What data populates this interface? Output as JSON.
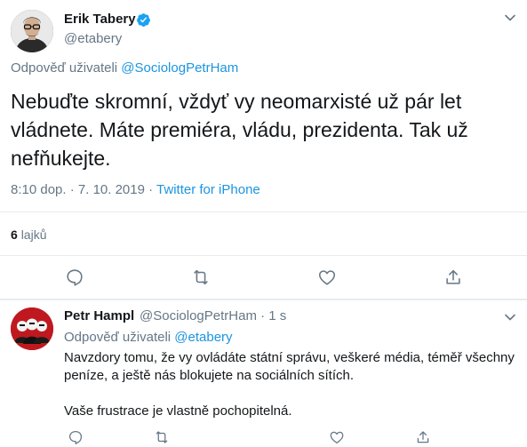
{
  "main_tweet": {
    "author_name": "Erik Tabery",
    "handle": "@etabery",
    "reply_prefix": "Odpověď uživateli",
    "reply_to": "@SociologPetrHam",
    "text_lines": [
      "Nebuďte skromní, vždyť vy neomarxisté už pár let",
      "vládnete. Máte premiéra, vládu, prezidenta. Tak už",
      "nefňukejte."
    ],
    "timestamp": "8:10 dop. · 7. 10. 2019 ·",
    "source": "Twitter for iPhone",
    "likes_count": "6",
    "likes_label": "lajků"
  },
  "reply_tweet": {
    "author_name": "Petr Hampl",
    "handle_time": "@SociologPetrHam · 1 s",
    "reply_prefix": "Odpověď uživateli",
    "reply_to": "@etabery",
    "text_lines": [
      "Navzdory tomu, že vy ovládáte státní správu, veškeré média, téměř všechny",
      "peníze, a ještě nás blokujete na sociálních sítích.",
      "Vaše frustrace je vlastně pochopitelná."
    ]
  },
  "icons": {
    "verified": "verified-badge-icon",
    "more": "chevron-down-icon",
    "reply": "reply-icon",
    "retweet": "retweet-icon",
    "like": "heart-icon",
    "share": "share-icon"
  },
  "colors": {
    "text": "#14171a",
    "muted": "#657786",
    "link": "#1b95e0",
    "divider": "#e6ecf0",
    "verified": "#1da1f2",
    "reply_avatar_bg": "#c0181f"
  }
}
